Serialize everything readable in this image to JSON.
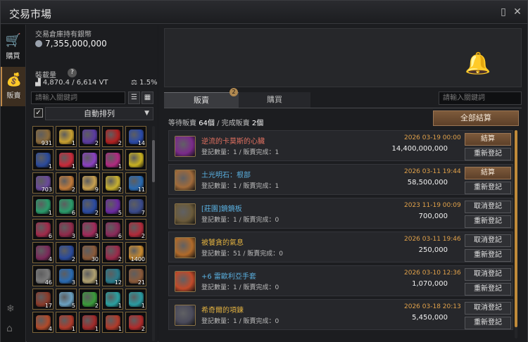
{
  "window": {
    "title": "交易市場"
  },
  "leftbar": {
    "buy_label": "購買",
    "sell_label": "販賣"
  },
  "inventory": {
    "silver_label": "交易倉庫持有銀幣",
    "silver_value": "7,355,000,000",
    "weight_label": "裝載量",
    "weight_value": "4,870.4 / 6,614 VT",
    "weight_pct": "1.5%",
    "search_placeholder": "請輸入關鍵詞",
    "sort_label": "自動排列",
    "items": [
      {
        "color": "#8a6a3a",
        "count": "931"
      },
      {
        "color": "#c8a030",
        "count": "1"
      },
      {
        "color": "#5a3aa0",
        "count": "2"
      },
      {
        "color": "#b02020",
        "count": "2"
      },
      {
        "color": "#2a4aa8",
        "count": "14"
      },
      {
        "color": "#2b4a9a",
        "count": "1"
      },
      {
        "color": "#c82a3a",
        "count": "1"
      },
      {
        "color": "#8a40c0",
        "count": "1"
      },
      {
        "color": "#b02a80",
        "count": "1"
      },
      {
        "color": "#c8b020",
        "count": ""
      },
      {
        "color": "#6a4a9a",
        "count": "703"
      },
      {
        "color": "#c07a3a",
        "count": "2"
      },
      {
        "color": "#c8a050",
        "count": "9"
      },
      {
        "color": "#c8b030",
        "count": "2"
      },
      {
        "color": "#2a6ab0",
        "count": "11"
      },
      {
        "color": "#2a9a6a",
        "count": "1"
      },
      {
        "color": "#2a9a6a",
        "count": "6"
      },
      {
        "color": "#2a4aa0",
        "count": "2"
      },
      {
        "color": "#6a2aa0",
        "count": "5"
      },
      {
        "color": "#3a4a8a",
        "count": "7"
      },
      {
        "color": "#a02a4a",
        "count": "6"
      },
      {
        "color": "#902a4a",
        "count": "3"
      },
      {
        "color": "#a02a5a",
        "count": "3"
      },
      {
        "color": "#8a2a5a",
        "count": "6"
      },
      {
        "color": "#b02a3a",
        "count": "2"
      },
      {
        "color": "#7a2a5a",
        "count": "4"
      },
      {
        "color": "#2a4a9a",
        "count": "2"
      },
      {
        "color": "#8a5a3a",
        "count": "30"
      },
      {
        "color": "#9a2a4a",
        "count": "2"
      },
      {
        "color": "#c88a30",
        "count": "1400"
      },
      {
        "color": "#7a7a7a",
        "count": "46"
      },
      {
        "color": "#2a6ab0",
        "count": "3"
      },
      {
        "color": "#b0a070",
        "count": "1"
      },
      {
        "color": "#2a7a8a",
        "count": "12"
      },
      {
        "color": "#8a5a3a",
        "count": "21"
      },
      {
        "color": "#8a3a2a",
        "count": "17"
      },
      {
        "color": "#6aa0c0",
        "count": "5"
      },
      {
        "color": "#3a9a3a",
        "count": "2"
      },
      {
        "color": "#2aa0a0",
        "count": "1"
      },
      {
        "color": "#2a9aa0",
        "count": "1"
      },
      {
        "color": "#b04a2a",
        "count": "4"
      },
      {
        "color": "#b03a2a",
        "count": "1"
      },
      {
        "color": "#a02a2a",
        "count": "1"
      },
      {
        "color": "#b03a2a",
        "count": "1"
      },
      {
        "color": "#b02a2a",
        "count": "2"
      }
    ]
  },
  "market": {
    "tab_sell": "販賣",
    "tab_buy": "購買",
    "tab_badge": "2",
    "search_placeholder": "請輸入關鍵詞",
    "pending_label": "等待販賣",
    "pending_value": "64個",
    "sep": "/",
    "done_label": "完成販賣",
    "done_value": "2個",
    "settle_all": "全部結算",
    "listings": [
      {
        "name": "逆流的卡莫斯的心臟",
        "name_color": "#e07060",
        "icon_color": "#7a2a8a",
        "sub": "登記數量：1 / 販賣完成：1",
        "date": "2026 03-19 00:00",
        "price": "14,400,000,000",
        "btn_top": "結算",
        "btn_bot": "重新登記",
        "top_gold": true
      },
      {
        "name": "土光明石：根部",
        "name_color": "#5ab0e0",
        "icon_color": "#a06a3a",
        "sub": "登記數量：1 / 販賣完成：1",
        "date": "2026 03-11 19:44",
        "price": "58,500,000",
        "btn_top": "結算",
        "btn_bot": "重新登記",
        "top_gold": true
      },
      {
        "name": "[莊園]鏡鏡板",
        "name_color": "#5ab0e0",
        "icon_color": "#6a5a3a",
        "sub": "登記數量：1 / 販賣完成：0",
        "date": "2023 11-19 00:09",
        "price": "700,000",
        "btn_top": "取消登記",
        "btn_bot": "重新登記",
        "top_gold": false
      },
      {
        "name": "被饕貪的氣息",
        "name_color": "#e0b040",
        "icon_color": "#b06a2a",
        "sub": "登記數量：51 / 販賣完成：0",
        "date": "2026 03-11 19:46",
        "price": "250,000",
        "btn_top": "取消登記",
        "btn_bot": "重新登記",
        "top_gold": false
      },
      {
        "name": "+6 雷歐利亞手套",
        "name_color": "#5ab0e0",
        "icon_color": "#c04a2a",
        "sub": "登記數量：1 / 販賣完成：0",
        "date": "2026 03-10 12:36",
        "price": "1,070,000",
        "btn_top": "取消登記",
        "btn_bot": "重新登記",
        "top_gold": false
      },
      {
        "name": "希奇爾的項鍊",
        "name_color": "#e0b040",
        "icon_color": "#4a4a5a",
        "sub": "登記數量：1 / 販賣完成：0",
        "date": "2026 03-18 20:13",
        "price": "5,450,000",
        "btn_top": "取消登記",
        "btn_bot": "重新登記",
        "top_gold": false
      }
    ]
  }
}
